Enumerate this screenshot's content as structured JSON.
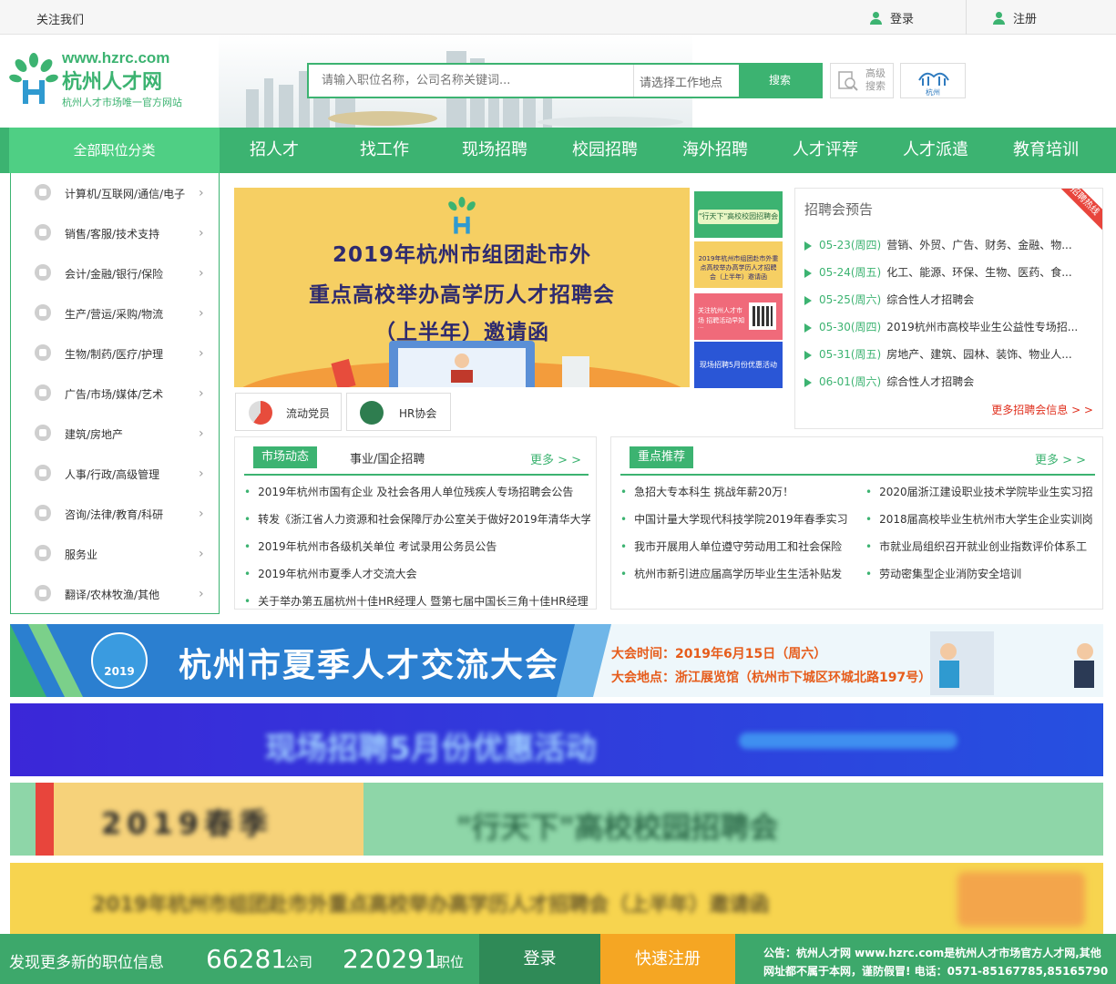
{
  "topbar": {
    "follow": "关注我们",
    "login": "登录",
    "register": "注册"
  },
  "logo": {
    "url": "www.hzrc.com",
    "name": "杭州人才网",
    "slogan": "杭州人才市场唯一官方网站"
  },
  "search": {
    "placeholder": "请输入职位名称，公司名称关键词...",
    "location": "请选择工作地点",
    "button": "搜索",
    "advanced": "高级搜索",
    "city": "杭州"
  },
  "nav": {
    "all": "全部职位分类",
    "items": [
      "招人才",
      "找工作",
      "现场招聘",
      "校园招聘",
      "海外招聘",
      "人才评荐",
      "人才派遣",
      "教育培训"
    ]
  },
  "categories": [
    "计算机/互联网/通信/电子",
    "销售/客服/技术支持",
    "会计/金融/银行/保险",
    "生产/营运/采购/物流",
    "生物/制药/医疗/护理",
    "广告/市场/媒体/艺术",
    "建筑/房地产",
    "人事/行政/高级管理",
    "咨询/法律/教育/科研",
    "服务业",
    "翻译/农林牧渔/其他"
  ],
  "banner": {
    "line1": "2019年杭州市组团赴市外",
    "line2": "重点高校举办高学历人才招聘会",
    "line3": "（上半年）邀请函"
  },
  "thumbs": [
    "\"行天下\"高校校园招聘会",
    "2019年杭州市组团赴市外重点高校举办高学历人才招聘会（上半年）邀请函",
    "关注杭州人才市场 招聘活动早知道",
    "现场招聘5月份优惠活动"
  ],
  "mini_links": [
    "流动党员",
    "HR协会"
  ],
  "job_fair": {
    "title": "招聘会预告",
    "ribbon": "招聘热线",
    "items": [
      {
        "date": "05-23(周四)",
        "text": "营销、外贸、广告、财务、金融、物..."
      },
      {
        "date": "05-24(周五)",
        "text": "化工、能源、环保、生物、医药、食..."
      },
      {
        "date": "05-25(周六)",
        "text": "综合性人才招聘会"
      },
      {
        "date": "05-30(周四)",
        "text": "2019杭州市高校毕业生公益性专场招..."
      },
      {
        "date": "05-31(周五)",
        "text": "房地产、建筑、园林、装饰、物业人..."
      },
      {
        "date": "06-01(周六)",
        "text": "综合性人才招聘会"
      }
    ],
    "more": "更多招聘会信息 > >"
  },
  "market": {
    "tab1": "市场动态",
    "tab2": "事业/国企招聘",
    "more": "更多 > >",
    "items": [
      "2019年杭州市国有企业 及社会各用人单位残疾人专场招聘会公告",
      "转发《浙江省人力资源和社会保障厅办公室关于做好2019年清华大学",
      "2019年杭州市各级机关单位 考试录用公务员公告",
      "2019年杭州市夏季人才交流大会",
      "关于举办第五届杭州十佳HR经理人 暨第七届中国长三角十佳HR经理"
    ]
  },
  "featured": {
    "tab1": "重点推荐",
    "more": "更多 > >",
    "left": [
      "急招大专本科生 挑战年薪20万！",
      "中国计量大学现代科技学院2019年春季实习",
      "我市开展用人单位遵守劳动用工和社会保险",
      "杭州市新引进应届高学历毕业生生活补贴发"
    ],
    "right": [
      "2020届浙江建设职业技术学院毕业生实习招",
      "2018届高校毕业生杭州市大学生企业实训岗",
      "市就业局组织召开就业创业指数评价体系工",
      "劳动密集型企业消防安全培训"
    ]
  },
  "summer_ad": {
    "year": "2019",
    "title": "杭州市夏季人才交流大会",
    "time": "大会时间：2019年6月15日（周六）",
    "place": "大会地点：浙江展览馆（杭州市下城区环城北路197号）"
  },
  "blur_ads": [
    "现场招聘5月份优惠活动",
    "2019春季",
    "\"行天下\"高校校园招聘会",
    "2019年杭州市组团赴市外重点高校举办高学历人才招聘会（上半年）邀请函"
  ],
  "footer": {
    "discover": "发现更多新的职位信息",
    "companies": "66281",
    "companies_unit": "公司",
    "jobs": "220291",
    "jobs_unit": "职位",
    "login": "登录",
    "register": "快速注册",
    "notice": "公告：杭州人才网 www.hzrc.com是杭州人才市场官方人才网,其他网址都不属于本网，谨防假冒! 电话：0571-85167785,85165790"
  },
  "colors": {
    "brand": "#3cb371",
    "accent": "#e0301e",
    "footer": "#3da86b",
    "register": "#f5a623"
  }
}
